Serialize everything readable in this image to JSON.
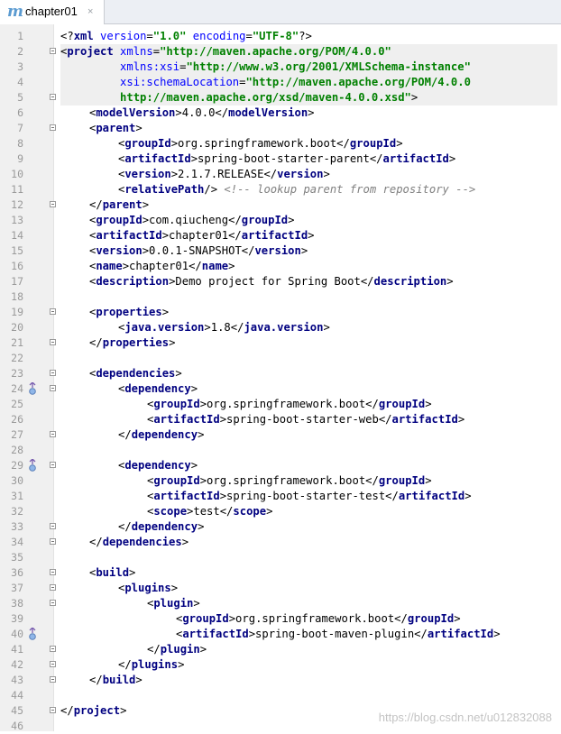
{
  "tab": {
    "label": "chapter01",
    "close_glyph": "×",
    "icon": "maven-m-icon"
  },
  "watermark": "https://blog.csdn.net/u012832088",
  "lines": [
    {
      "n": "1",
      "indent": 0,
      "fold": false,
      "marker": false,
      "hl": false,
      "seg": [
        [
          "p",
          "<?"
        ],
        [
          "t",
          "xml "
        ],
        [
          "a",
          "version"
        ],
        [
          "p",
          "="
        ],
        [
          "v",
          "\"1.0\" "
        ],
        [
          "a",
          "encoding"
        ],
        [
          "p",
          "="
        ],
        [
          "v",
          "\"UTF-8\""
        ],
        [
          "p",
          "?>"
        ]
      ]
    },
    {
      "n": "2",
      "indent": 0,
      "fold": true,
      "marker": false,
      "hl": true,
      "seg": [
        [
          "p",
          "<"
        ],
        [
          "t",
          "project "
        ],
        [
          "a",
          "xmlns"
        ],
        [
          "p",
          "="
        ],
        [
          "v",
          "\"http://maven.apache.org/POM/4.0.0\""
        ]
      ]
    },
    {
      "n": "3",
      "indent": 0,
      "fold": false,
      "marker": false,
      "hl": true,
      "seg": [
        [
          "p",
          "         "
        ],
        [
          "a",
          "xmlns:xsi"
        ],
        [
          "p",
          "="
        ],
        [
          "v",
          "\"http://www.w3.org/2001/XMLSchema-instance\""
        ]
      ]
    },
    {
      "n": "4",
      "indent": 0,
      "fold": false,
      "marker": false,
      "hl": true,
      "seg": [
        [
          "p",
          "         "
        ],
        [
          "a",
          "xsi:schemaLocation"
        ],
        [
          "p",
          "="
        ],
        [
          "v",
          "\"http://maven.apache.org/POM/4.0.0"
        ]
      ]
    },
    {
      "n": "5",
      "indent": 0,
      "fold": true,
      "marker": false,
      "hl": true,
      "seg": [
        [
          "p",
          "         "
        ],
        [
          "v",
          "http://maven.apache.org/xsd/maven-4.0.0.xsd\""
        ],
        [
          "p",
          ">"
        ]
      ]
    },
    {
      "n": "6",
      "indent": 1,
      "fold": false,
      "marker": false,
      "hl": false,
      "seg": [
        [
          "p",
          "<"
        ],
        [
          "t",
          "modelVersion"
        ],
        [
          "p",
          ">4.0.0</"
        ],
        [
          "t",
          "modelVersion"
        ],
        [
          "p",
          ">"
        ]
      ]
    },
    {
      "n": "7",
      "indent": 1,
      "fold": true,
      "marker": false,
      "hl": false,
      "seg": [
        [
          "p",
          "<"
        ],
        [
          "t",
          "parent"
        ],
        [
          "p",
          ">"
        ]
      ]
    },
    {
      "n": "8",
      "indent": 2,
      "fold": false,
      "marker": false,
      "hl": false,
      "seg": [
        [
          "p",
          "<"
        ],
        [
          "t",
          "groupId"
        ],
        [
          "p",
          ">org.springframework.boot</"
        ],
        [
          "t",
          "groupId"
        ],
        [
          "p",
          ">"
        ]
      ]
    },
    {
      "n": "9",
      "indent": 2,
      "fold": false,
      "marker": false,
      "hl": false,
      "seg": [
        [
          "p",
          "<"
        ],
        [
          "t",
          "artifactId"
        ],
        [
          "p",
          ">spring-boot-starter-parent</"
        ],
        [
          "t",
          "artifactId"
        ],
        [
          "p",
          ">"
        ]
      ]
    },
    {
      "n": "10",
      "indent": 2,
      "fold": false,
      "marker": false,
      "hl": false,
      "seg": [
        [
          "p",
          "<"
        ],
        [
          "t",
          "version"
        ],
        [
          "p",
          ">2.1.7.RELEASE</"
        ],
        [
          "t",
          "version"
        ],
        [
          "p",
          ">"
        ]
      ]
    },
    {
      "n": "11",
      "indent": 2,
      "fold": false,
      "marker": false,
      "hl": false,
      "seg": [
        [
          "p",
          "<"
        ],
        [
          "t",
          "relativePath"
        ],
        [
          "p",
          "/> "
        ],
        [
          "c",
          "<!-- lookup parent from repository -->"
        ]
      ]
    },
    {
      "n": "12",
      "indent": 1,
      "fold": true,
      "marker": false,
      "hl": false,
      "seg": [
        [
          "p",
          "</"
        ],
        [
          "t",
          "parent"
        ],
        [
          "p",
          ">"
        ]
      ]
    },
    {
      "n": "13",
      "indent": 1,
      "fold": false,
      "marker": false,
      "hl": false,
      "seg": [
        [
          "p",
          "<"
        ],
        [
          "t",
          "groupId"
        ],
        [
          "p",
          ">com.qiucheng</"
        ],
        [
          "t",
          "groupId"
        ],
        [
          "p",
          ">"
        ]
      ]
    },
    {
      "n": "14",
      "indent": 1,
      "fold": false,
      "marker": false,
      "hl": false,
      "seg": [
        [
          "p",
          "<"
        ],
        [
          "t",
          "artifactId"
        ],
        [
          "p",
          ">chapter01</"
        ],
        [
          "t",
          "artifactId"
        ],
        [
          "p",
          ">"
        ]
      ]
    },
    {
      "n": "15",
      "indent": 1,
      "fold": false,
      "marker": false,
      "hl": false,
      "seg": [
        [
          "p",
          "<"
        ],
        [
          "t",
          "version"
        ],
        [
          "p",
          ">0.0.1-SNAPSHOT</"
        ],
        [
          "t",
          "version"
        ],
        [
          "p",
          ">"
        ]
      ]
    },
    {
      "n": "16",
      "indent": 1,
      "fold": false,
      "marker": false,
      "hl": false,
      "seg": [
        [
          "p",
          "<"
        ],
        [
          "t",
          "name"
        ],
        [
          "p",
          ">chapter01</"
        ],
        [
          "t",
          "name"
        ],
        [
          "p",
          ">"
        ]
      ]
    },
    {
      "n": "17",
      "indent": 1,
      "fold": false,
      "marker": false,
      "hl": false,
      "seg": [
        [
          "p",
          "<"
        ],
        [
          "t",
          "description"
        ],
        [
          "p",
          ">Demo project for Spring Boot</"
        ],
        [
          "t",
          "description"
        ],
        [
          "p",
          ">"
        ]
      ]
    },
    {
      "n": "18",
      "indent": 0,
      "fold": false,
      "marker": false,
      "hl": false,
      "seg": []
    },
    {
      "n": "19",
      "indent": 1,
      "fold": true,
      "marker": false,
      "hl": false,
      "seg": [
        [
          "p",
          "<"
        ],
        [
          "t",
          "properties"
        ],
        [
          "p",
          ">"
        ]
      ]
    },
    {
      "n": "20",
      "indent": 2,
      "fold": false,
      "marker": false,
      "hl": false,
      "seg": [
        [
          "p",
          "<"
        ],
        [
          "t",
          "java.version"
        ],
        [
          "p",
          ">1.8</"
        ],
        [
          "t",
          "java.version"
        ],
        [
          "p",
          ">"
        ]
      ]
    },
    {
      "n": "21",
      "indent": 1,
      "fold": true,
      "marker": false,
      "hl": false,
      "seg": [
        [
          "p",
          "</"
        ],
        [
          "t",
          "properties"
        ],
        [
          "p",
          ">"
        ]
      ]
    },
    {
      "n": "22",
      "indent": 0,
      "fold": false,
      "marker": false,
      "hl": false,
      "seg": []
    },
    {
      "n": "23",
      "indent": 1,
      "fold": true,
      "marker": false,
      "hl": false,
      "seg": [
        [
          "p",
          "<"
        ],
        [
          "t",
          "dependencies"
        ],
        [
          "p",
          ">"
        ]
      ]
    },
    {
      "n": "24",
      "indent": 2,
      "fold": true,
      "marker": true,
      "hl": false,
      "seg": [
        [
          "p",
          "<"
        ],
        [
          "t",
          "dependency"
        ],
        [
          "p",
          ">"
        ]
      ]
    },
    {
      "n": "25",
      "indent": 3,
      "fold": false,
      "marker": false,
      "hl": false,
      "seg": [
        [
          "p",
          "<"
        ],
        [
          "t",
          "groupId"
        ],
        [
          "p",
          ">org.springframework.boot</"
        ],
        [
          "t",
          "groupId"
        ],
        [
          "p",
          ">"
        ]
      ]
    },
    {
      "n": "26",
      "indent": 3,
      "fold": false,
      "marker": false,
      "hl": false,
      "seg": [
        [
          "p",
          "<"
        ],
        [
          "t",
          "artifactId"
        ],
        [
          "p",
          ">spring-boot-starter-web</"
        ],
        [
          "t",
          "artifactId"
        ],
        [
          "p",
          ">"
        ]
      ]
    },
    {
      "n": "27",
      "indent": 2,
      "fold": true,
      "marker": false,
      "hl": false,
      "seg": [
        [
          "p",
          "</"
        ],
        [
          "t",
          "dependency"
        ],
        [
          "p",
          ">"
        ]
      ]
    },
    {
      "n": "28",
      "indent": 0,
      "fold": false,
      "marker": false,
      "hl": false,
      "seg": []
    },
    {
      "n": "29",
      "indent": 2,
      "fold": true,
      "marker": true,
      "hl": false,
      "seg": [
        [
          "p",
          "<"
        ],
        [
          "t",
          "dependency"
        ],
        [
          "p",
          ">"
        ]
      ]
    },
    {
      "n": "30",
      "indent": 3,
      "fold": false,
      "marker": false,
      "hl": false,
      "seg": [
        [
          "p",
          "<"
        ],
        [
          "t",
          "groupId"
        ],
        [
          "p",
          ">org.springframework.boot</"
        ],
        [
          "t",
          "groupId"
        ],
        [
          "p",
          ">"
        ]
      ]
    },
    {
      "n": "31",
      "indent": 3,
      "fold": false,
      "marker": false,
      "hl": false,
      "seg": [
        [
          "p",
          "<"
        ],
        [
          "t",
          "artifactId"
        ],
        [
          "p",
          ">spring-boot-starter-test</"
        ],
        [
          "t",
          "artifactId"
        ],
        [
          "p",
          ">"
        ]
      ]
    },
    {
      "n": "32",
      "indent": 3,
      "fold": false,
      "marker": false,
      "hl": false,
      "seg": [
        [
          "p",
          "<"
        ],
        [
          "t",
          "scope"
        ],
        [
          "p",
          ">test</"
        ],
        [
          "t",
          "scope"
        ],
        [
          "p",
          ">"
        ]
      ]
    },
    {
      "n": "33",
      "indent": 2,
      "fold": true,
      "marker": false,
      "hl": false,
      "seg": [
        [
          "p",
          "</"
        ],
        [
          "t",
          "dependency"
        ],
        [
          "p",
          ">"
        ]
      ]
    },
    {
      "n": "34",
      "indent": 1,
      "fold": true,
      "marker": false,
      "hl": false,
      "seg": [
        [
          "p",
          "</"
        ],
        [
          "t",
          "dependencies"
        ],
        [
          "p",
          ">"
        ]
      ]
    },
    {
      "n": "35",
      "indent": 0,
      "fold": false,
      "marker": false,
      "hl": false,
      "seg": []
    },
    {
      "n": "36",
      "indent": 1,
      "fold": true,
      "marker": false,
      "hl": false,
      "seg": [
        [
          "p",
          "<"
        ],
        [
          "t",
          "build"
        ],
        [
          "p",
          ">"
        ]
      ]
    },
    {
      "n": "37",
      "indent": 2,
      "fold": true,
      "marker": false,
      "hl": false,
      "seg": [
        [
          "p",
          "<"
        ],
        [
          "t",
          "plugins"
        ],
        [
          "p",
          ">"
        ]
      ]
    },
    {
      "n": "38",
      "indent": 3,
      "fold": true,
      "marker": false,
      "hl": false,
      "seg": [
        [
          "p",
          "<"
        ],
        [
          "t",
          "plugin"
        ],
        [
          "p",
          ">"
        ]
      ]
    },
    {
      "n": "39",
      "indent": 4,
      "fold": false,
      "marker": false,
      "hl": false,
      "seg": [
        [
          "p",
          "<"
        ],
        [
          "t",
          "groupId"
        ],
        [
          "p",
          ">org.springframework.boot</"
        ],
        [
          "t",
          "groupId"
        ],
        [
          "p",
          ">"
        ]
      ]
    },
    {
      "n": "40",
      "indent": 4,
      "fold": false,
      "marker": true,
      "hl": false,
      "seg": [
        [
          "p",
          "<"
        ],
        [
          "t",
          "artifactId"
        ],
        [
          "p",
          ">spring-boot-maven-plugin</"
        ],
        [
          "t",
          "artifactId"
        ],
        [
          "p",
          ">"
        ]
      ]
    },
    {
      "n": "41",
      "indent": 3,
      "fold": true,
      "marker": false,
      "hl": false,
      "seg": [
        [
          "p",
          "</"
        ],
        [
          "t",
          "plugin"
        ],
        [
          "p",
          ">"
        ]
      ]
    },
    {
      "n": "42",
      "indent": 2,
      "fold": true,
      "marker": false,
      "hl": false,
      "seg": [
        [
          "p",
          "</"
        ],
        [
          "t",
          "plugins"
        ],
        [
          "p",
          ">"
        ]
      ]
    },
    {
      "n": "43",
      "indent": 1,
      "fold": true,
      "marker": false,
      "hl": false,
      "seg": [
        [
          "p",
          "</"
        ],
        [
          "t",
          "build"
        ],
        [
          "p",
          ">"
        ]
      ]
    },
    {
      "n": "44",
      "indent": 0,
      "fold": false,
      "marker": false,
      "hl": false,
      "seg": []
    },
    {
      "n": "45",
      "indent": 0,
      "fold": true,
      "marker": false,
      "hl": false,
      "seg": [
        [
          "p",
          "</"
        ],
        [
          "t",
          "project"
        ],
        [
          "p",
          ">"
        ]
      ]
    },
    {
      "n": "46",
      "indent": 0,
      "fold": false,
      "marker": false,
      "hl": false,
      "seg": []
    }
  ]
}
